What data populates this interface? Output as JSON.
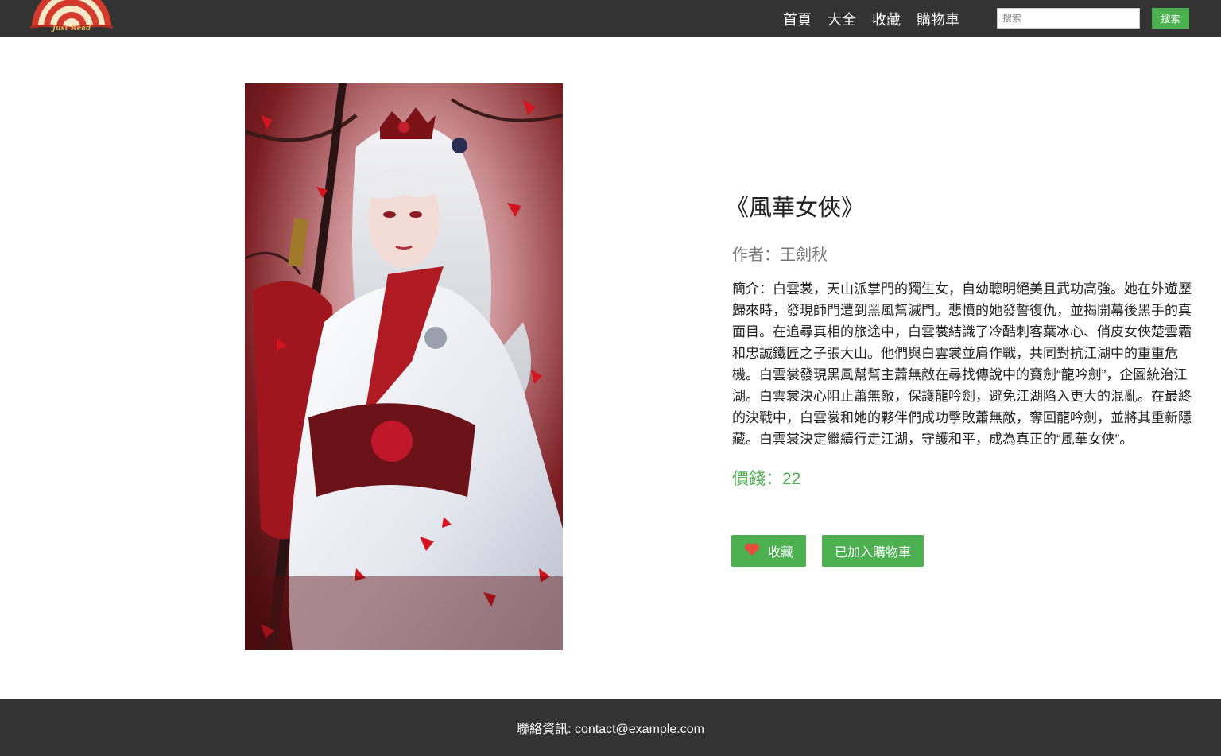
{
  "header": {
    "logo_text": "Just Read",
    "nav": [
      {
        "label": "首頁"
      },
      {
        "label": "大全"
      },
      {
        "label": "收藏"
      },
      {
        "label": "購物車"
      }
    ],
    "search": {
      "placeholder": "搜索",
      "value": "",
      "button_label": "搜索"
    }
  },
  "book": {
    "title": "《風華女俠》",
    "author": "作者：王劍秋",
    "summary": "簡介：白雲裳，天山派掌門的獨生女，自幼聰明絕美且武功高強。她在外遊歷歸來時，發現師門遭到黑風幫滅門。悲憤的她發誓復仇，並揭開幕後黑手的真面目。在追尋真相的旅途中，白雲裳結識了冷酷刺客葉冰心、俏皮女俠楚雲霜和忠誠鐵匠之子張大山。他們與白雲裳並肩作戰，共同對抗江湖中的重重危機。白雲裳發現黑風幫幫主蕭無敵在尋找傳說中的寶劍“龍吟劍”，企圖統治江湖。白雲裳決心阻止蕭無敵，保護龍吟劍，避免江湖陷入更大的混亂。在最終的決戰中，白雲裳和她的夥伴們成功擊敗蕭無敵，奪回龍吟劍，並將其重新隱藏。白雲裳決定繼續行走江湖，守護和平，成為真正的“風華女俠”。",
    "price": "價錢：22",
    "cover_alt": "white-haired swordswoman in red and white robes among red maple leaves"
  },
  "actions": {
    "favorite_label": "收藏",
    "cart_label": "已加入購物車"
  },
  "footer": {
    "contact": "聯絡資訊: contact@example.com"
  },
  "colors": {
    "nav_bg": "#333333",
    "accent_green": "#4caf50",
    "heart_red": "#e74c3c"
  },
  "icons": {
    "logo": "rainbow-fan-book-logo",
    "favorite": "heart-icon"
  }
}
